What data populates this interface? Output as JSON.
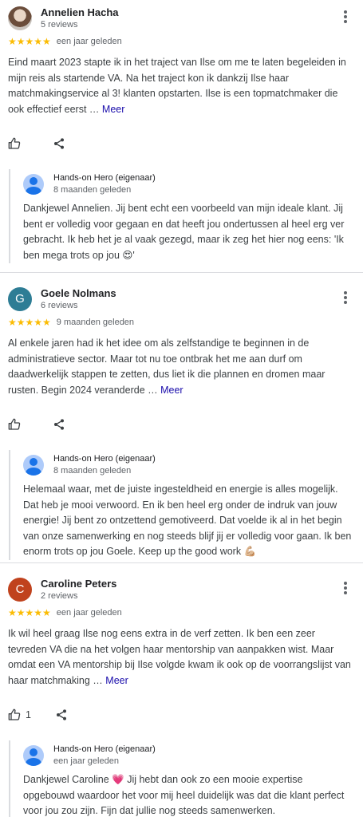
{
  "reviews": [
    {
      "name": "Annelien Hacha",
      "reviews_count": "5 reviews",
      "stars": "★★★★★",
      "date": "een jaar geleden",
      "text": "Eind maart 2023 stapte ik in het traject van Ilse om me te laten begeleiden in mijn reis als startende VA. Na het traject kon ik dankzij Ilse haar matchmakingservice al 3! klanten opstarten. Ilse is een topmatchmaker die ook effectief eerst …",
      "more_label": "Meer",
      "likes": "",
      "reply": {
        "owner": "Hands-on Hero (eigenaar)",
        "date": "8 maanden geleden",
        "text": "Dankjewel Annelien. Jij bent echt een voorbeeld van mijn ideale klant. Jij bent er volledig voor gegaan en dat heeft jou ondertussen al heel erg ver gebracht. Ik heb het je al vaak gezegd, maar ik zeg het hier nog eens: 'Ik ben mega trots op jou 😍'"
      }
    },
    {
      "name": "Goele Nolmans",
      "initial": "G",
      "reviews_count": "6 reviews",
      "stars": "★★★★★",
      "date": "9 maanden geleden",
      "text": "Al enkele jaren had ik het idee om als zelfstandige te beginnen in de administratieve sector. Maar tot nu toe ontbrak het me aan durf om daadwerkelijk stappen te zetten, dus liet ik die plannen en dromen maar rusten. Begin 2024 veranderde …",
      "more_label": "Meer",
      "likes": "",
      "reply": {
        "owner": "Hands-on Hero (eigenaar)",
        "date": "8 maanden geleden",
        "text": "Helemaal waar, met de juiste ingesteldheid en energie is alles mogelijk. Dat heb je mooi verwoord. En ik ben heel erg onder de indruk van jouw energie! Jij bent zo ontzettend gemotiveerd. Dat voelde ik al in het begin van onze samenwerking en nog steeds blijf jij er volledig voor gaan. Ik ben enorm trots op jou Goele. Keep up the good work 💪🏼"
      }
    },
    {
      "name": "Caroline Peters",
      "initial": "C",
      "reviews_count": "2 reviews",
      "stars": "★★★★★",
      "date": "een jaar geleden",
      "text": "Ik wil heel graag Ilse nog eens extra in de verf zetten. Ik ben een zeer tevreden VA die na het volgen haar mentorship van aanpakken wist. Maar omdat een VA mentorship bij Ilse volgde kwam ik ook op de voorrangslijst van haar matchmaking …",
      "more_label": "Meer",
      "likes": "1",
      "reply": {
        "owner": "Hands-on Hero (eigenaar)",
        "date": "een jaar geleden",
        "text": "Dankjewel Caroline 💗 Jij hebt dan ook zo een mooie expertise opgebouwd waardoor het voor mij heel duidelijk was dat die klant perfect voor jou zou zijn. Fijn dat jullie nog steeds samenwerken."
      }
    }
  ],
  "colors": {
    "goele_avatar": "#2e7d95",
    "caroline_avatar": "#c0421d",
    "stars": "#fbbc04",
    "link": "#1a0dab"
  },
  "icons": [
    "more-vert-icon",
    "thumb-up-icon",
    "share-icon",
    "owner-avatar-icon"
  ]
}
